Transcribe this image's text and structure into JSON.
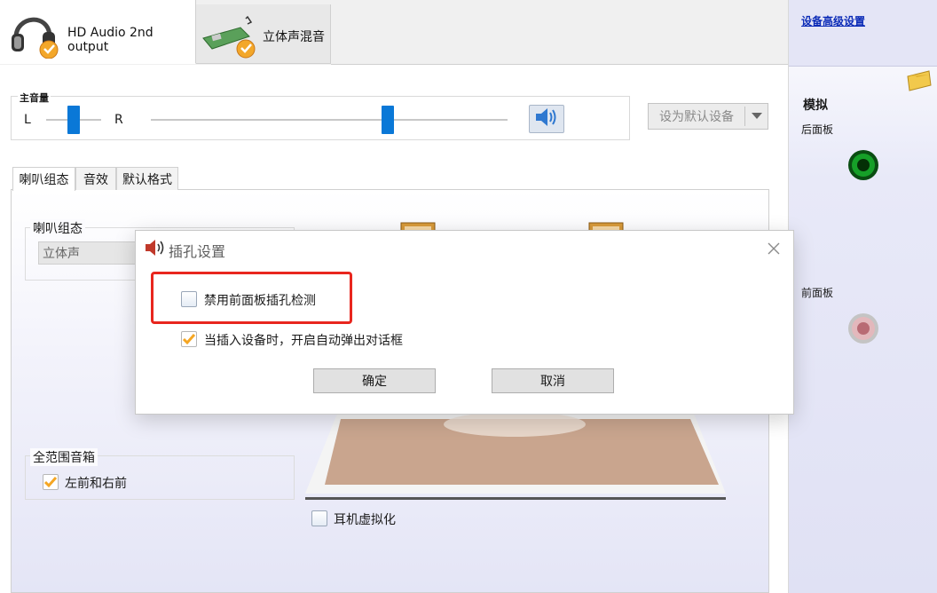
{
  "device_tabs": [
    {
      "label": "HD Audio 2nd output",
      "icon": "headphones-icon",
      "active": true
    },
    {
      "label": "立体声混音",
      "icon": "sound-card-icon",
      "active": false
    }
  ],
  "main_volume": {
    "title": "主音量",
    "left_label": "L",
    "right_label": "R",
    "balance_position": 0.5,
    "volume_level": 0.66
  },
  "default_device_button": "设为默认设备",
  "sub_tabs": [
    "喇叭组态",
    "音效",
    "默认格式"
  ],
  "speaker_config": {
    "group_title": "喇叭组态",
    "selected": "立体声"
  },
  "full_range": {
    "group_title": "全范围音箱",
    "checkbox_label": "左前和右前",
    "checked": true
  },
  "headphone_virtualization": {
    "label": "耳机虚拟化",
    "checked": false
  },
  "right_panel": {
    "advanced_link": "设备高级设置",
    "section_title": "模拟",
    "back_panel_label": "后面板",
    "front_panel_label": "前面板"
  },
  "dialog": {
    "title": "插孔设置",
    "option1": {
      "label": "禁用前面板插孔检测",
      "checked": false
    },
    "option2": {
      "label": "当插入设备时，开启自动弹出对话框",
      "checked": true
    },
    "ok_label": "确定",
    "cancel_label": "取消"
  },
  "colors": {
    "accent": "#0a78d7",
    "checkbox_check": "#f5a623",
    "jack_green": "#0f8a1c",
    "jack_pink": "#d9a4a8",
    "highlight": "#e8261e"
  }
}
